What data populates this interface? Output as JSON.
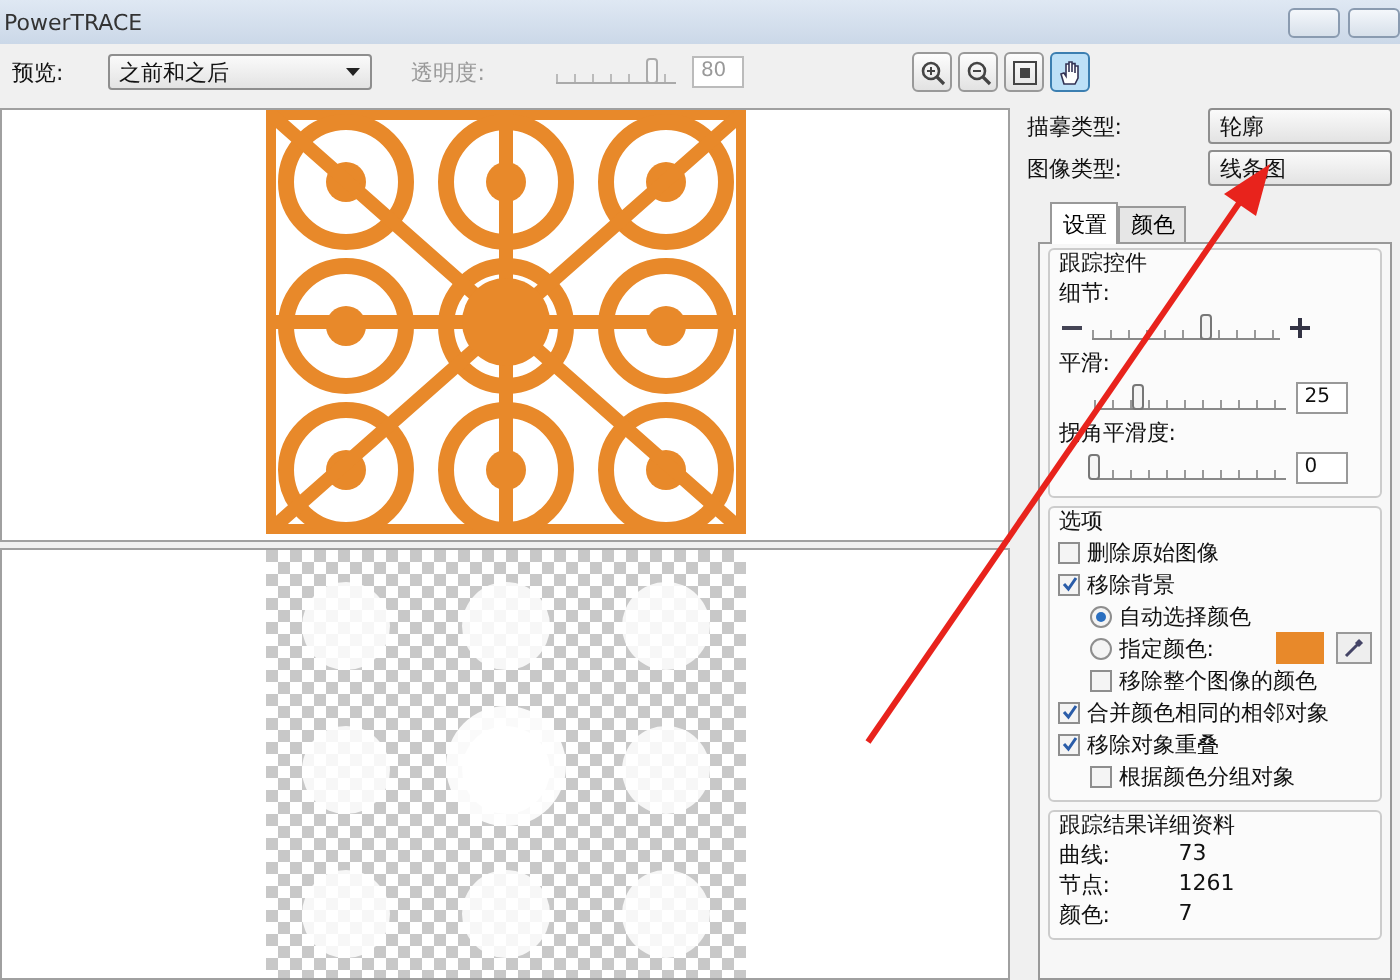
{
  "window": {
    "title": "PowerTRACE"
  },
  "toolbar": {
    "preview_label": "预览:",
    "preview_value": "之前和之后",
    "transparency_label": "透明度:",
    "transparency": {
      "level": 0.8,
      "value": "80"
    },
    "tools": [
      {
        "kind": "zoom-in",
        "selected": false
      },
      {
        "kind": "zoom-out",
        "selected": false
      },
      {
        "kind": "fit",
        "selected": false
      },
      {
        "kind": "pan",
        "selected": true
      }
    ]
  },
  "settings": {
    "trace_type_label": "描摹类型:",
    "trace_type": "轮廓",
    "image_type_label": "图像类型:",
    "image_type": "线条图",
    "tabs": [
      {
        "label": "设置",
        "selected": true
      },
      {
        "label": "颜色",
        "selected": false
      }
    ],
    "trace_controls": {
      "title": "跟踪控件",
      "sliders": [
        {
          "label": "细节:",
          "level": 0.6,
          "buttons": true
        },
        {
          "label": "平滑:",
          "level": 0.23,
          "value": "25"
        },
        {
          "label": "拐角平滑度:",
          "level": 0,
          "value": "0"
        }
      ]
    },
    "options": {
      "title": "选项",
      "items": [
        {
          "kind": "checkbox",
          "label": "删除原始图像",
          "checked": false
        },
        {
          "kind": "checkbox",
          "label": "移除背景",
          "checked": true,
          "children": [
            {
              "kind": "radio",
              "label": "自动选择颜色",
              "selected": true
            },
            {
              "kind": "radio-color",
              "label": "指定颜色:",
              "selected": false
            },
            {
              "kind": "checkbox",
              "label": "移除整个图像的颜色",
              "checked": false
            }
          ]
        },
        {
          "kind": "checkbox",
          "label": "合并颜色相同的相邻对象",
          "checked": true
        },
        {
          "kind": "checkbox",
          "label": "移除对象重叠",
          "checked": true,
          "children": [
            {
              "kind": "checkbox",
              "label": "根据颜色分组对象",
              "checked": false
            }
          ]
        }
      ]
    },
    "results": {
      "title": "跟踪结果详细资料",
      "rows": [
        {
          "label": "曲线:",
          "value": "73"
        },
        {
          "label": "节点:",
          "value": "1261"
        },
        {
          "label": "颜色:",
          "value": "7"
        }
      ]
    }
  }
}
